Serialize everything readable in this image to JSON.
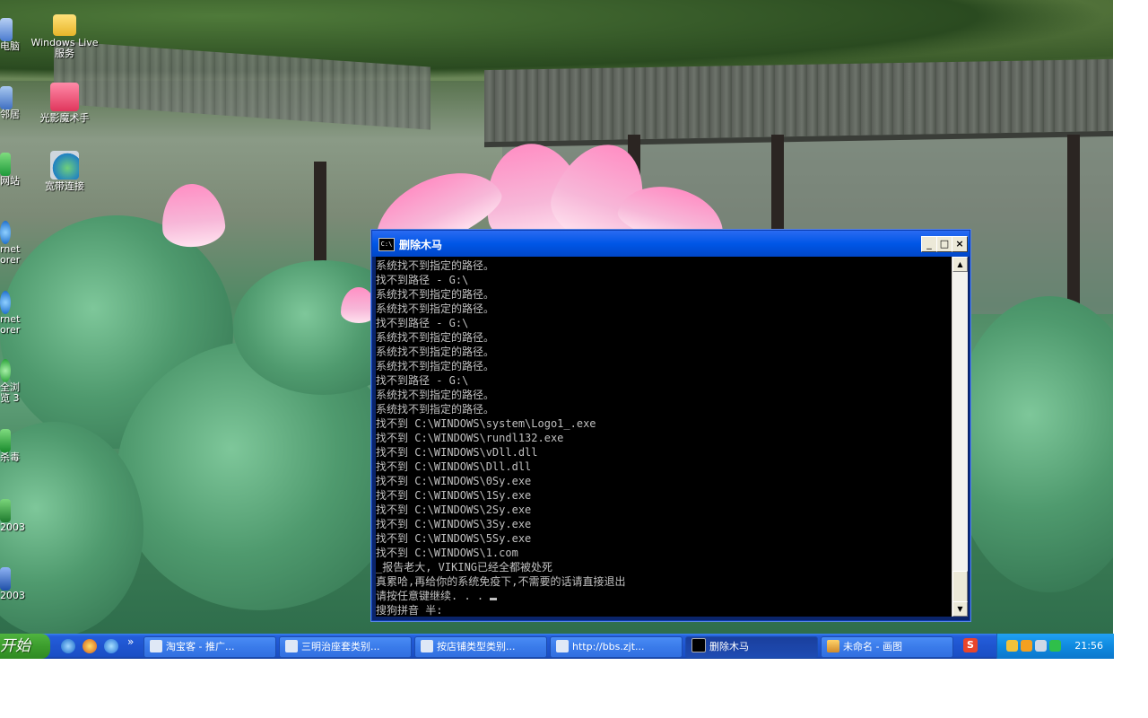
{
  "desktop": {
    "icons": [
      {
        "id": "my-computer",
        "label": "电脑"
      },
      {
        "id": "windows-live",
        "label": "Windows Live 服务"
      },
      {
        "id": "network",
        "label": "邻居"
      },
      {
        "id": "guangying",
        "label": "光影魔术手"
      },
      {
        "id": "site",
        "label": "网站"
      },
      {
        "id": "broadband",
        "label": "宽带连接"
      },
      {
        "id": "ie1",
        "label": "rnet orer"
      },
      {
        "id": "ie2",
        "label": "rnet orer"
      },
      {
        "id": "browser360",
        "label": "全浏览 3"
      },
      {
        "id": "antivirus",
        "label": "杀毒"
      },
      {
        "id": "excel",
        "label": "2003"
      },
      {
        "id": "word",
        "label": "2003"
      }
    ]
  },
  "console": {
    "title": "删除木马",
    "icon_text": "C:\\",
    "buttons": {
      "minimize": "_",
      "maximize": "□",
      "close": "×"
    },
    "lines": [
      "系统找不到指定的路径。",
      "找不到路径 - G:\\",
      "系统找不到指定的路径。",
      "系统找不到指定的路径。",
      "找不到路径 - G:\\",
      "系统找不到指定的路径。",
      "系统找不到指定的路径。",
      "系统找不到指定的路径。",
      "找不到路径 - G:\\",
      "系统找不到指定的路径。",
      "系统找不到指定的路径。",
      "找不到 C:\\WINDOWS\\system\\Logo1_.exe",
      "找不到 C:\\WINDOWS\\rundl132.exe",
      "找不到 C:\\WINDOWS\\vDll.dll",
      "找不到 C:\\WINDOWS\\Dll.dll",
      "找不到 C:\\WINDOWS\\0Sy.exe",
      "找不到 C:\\WINDOWS\\1Sy.exe",
      "找不到 C:\\WINDOWS\\2Sy.exe",
      "找不到 C:\\WINDOWS\\3Sy.exe",
      "找不到 C:\\WINDOWS\\5Sy.exe",
      "找不到 C:\\WINDOWS\\1.com",
      "_报告老大, VIKING已经全都被处死",
      "真累哈,再给你的系统免疫下,不需要的话请直接退出",
      "请按任意键继续. . . "
    ],
    "ime_line": "搜狗拼音 半:"
  },
  "taskbar": {
    "start_label": "开始",
    "quick_launch_more": "»",
    "tasks": [
      {
        "label": "淘宝客 - 推广...",
        "active": false
      },
      {
        "label": "三明治座套类别...",
        "active": false
      },
      {
        "label": "按店铺类型类别...",
        "active": false
      },
      {
        "label": "http://bbs.zjt...",
        "active": false
      },
      {
        "label": "删除木马",
        "active": true
      },
      {
        "label": "未命名 - 画图",
        "active": false
      }
    ],
    "ime_icon": "S",
    "clock": "21:56"
  },
  "colors": {
    "taskbar_blue": "#245edb",
    "start_green": "#3c9d2d",
    "tray_blue": "#0f8ae0",
    "console_bg": "#000000",
    "console_text": "#c0c0c0",
    "title_blue": "#0056e6"
  }
}
